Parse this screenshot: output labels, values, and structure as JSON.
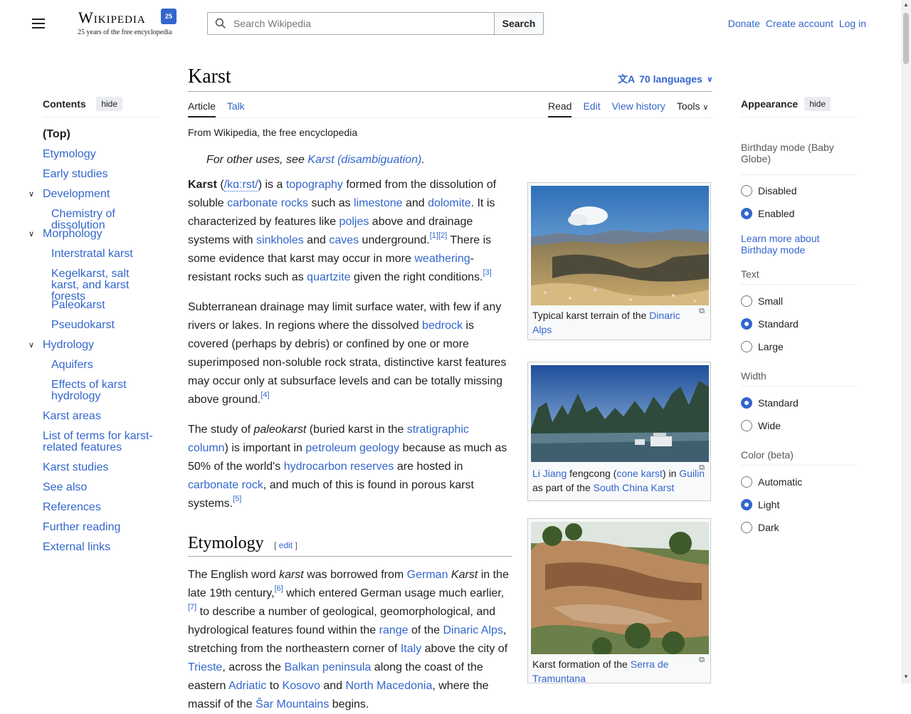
{
  "header": {
    "logo_wordmark": "Wikipedia",
    "logo_badge": "25",
    "tagline": "25 years of the free encyclopedia",
    "search_placeholder": "Search Wikipedia",
    "search_button": "Search",
    "donate": "Donate",
    "create_account": "Create account",
    "log_in": "Log in"
  },
  "toc": {
    "title": "Contents",
    "hide": "hide",
    "items": [
      {
        "label": "(Top)",
        "level": 1
      },
      {
        "label": "Etymology",
        "level": 1
      },
      {
        "label": "Early studies",
        "level": 1
      },
      {
        "label": "Development",
        "level": 1,
        "expandable": true
      },
      {
        "label": "Chemistry of dissolution",
        "level": 2
      },
      {
        "label": "Morphology",
        "level": 1,
        "expandable": true
      },
      {
        "label": "Interstratal karst",
        "level": 2
      },
      {
        "label": "Kegelkarst, salt karst, and karst forests",
        "level": 2
      },
      {
        "label": "Paleokarst",
        "level": 2
      },
      {
        "label": "Pseudokarst",
        "level": 2
      },
      {
        "label": "Hydrology",
        "level": 1,
        "expandable": true
      },
      {
        "label": "Aquifers",
        "level": 2
      },
      {
        "label": "Effects of karst hydrology",
        "level": 2
      },
      {
        "label": "Karst areas",
        "level": 1
      },
      {
        "label": "List of terms for karst-related features",
        "level": 1
      },
      {
        "label": "Karst studies",
        "level": 1
      },
      {
        "label": "See also",
        "level": 1
      },
      {
        "label": "References",
        "level": 1
      },
      {
        "label": "Further reading",
        "level": 1
      },
      {
        "label": "External links",
        "level": 1
      }
    ]
  },
  "article": {
    "title": "Karst",
    "languages": "70 languages",
    "tab_article": "Article",
    "tab_talk": "Talk",
    "tab_read": "Read",
    "tab_edit": "Edit",
    "tab_history": "View history",
    "tab_tools": "Tools",
    "from": "From Wikipedia, the free encyclopedia",
    "hatnote_prefix": "For other uses, see ",
    "hatnote_link": "Karst (disambiguation)",
    "hatnote_suffix": ".",
    "section_etymology": "Etymology",
    "edit_link": "edit"
  },
  "figures": [
    {
      "caption_text": "Typical karst terrain of the ",
      "caption_link": "Dinaric Alps"
    },
    {
      "caption": "Li Jiang fengcong (cone karst) in Guilin as part of the South China Karst"
    },
    {
      "caption_text": "Karst formation of the ",
      "caption_link": "Serra de Tramuntana"
    }
  ],
  "appearance": {
    "title": "Appearance",
    "hide": "hide",
    "birthday_label": "Birthday mode (Baby Globe)",
    "birthday_options": [
      "Disabled",
      "Enabled"
    ],
    "birthday_selected": "Enabled",
    "birthday_learn": "Learn more about Birthday mode",
    "text_label": "Text",
    "text_options": [
      "Small",
      "Standard",
      "Large"
    ],
    "text_selected": "Standard",
    "width_label": "Width",
    "width_options": [
      "Standard",
      "Wide"
    ],
    "width_selected": "Standard",
    "color_label": "Color (beta)",
    "color_options": [
      "Automatic",
      "Light",
      "Dark"
    ],
    "color_selected": "Light"
  },
  "colors": {
    "link": "#3366cc",
    "text": "#202122",
    "border": "#a2a9b1"
  }
}
